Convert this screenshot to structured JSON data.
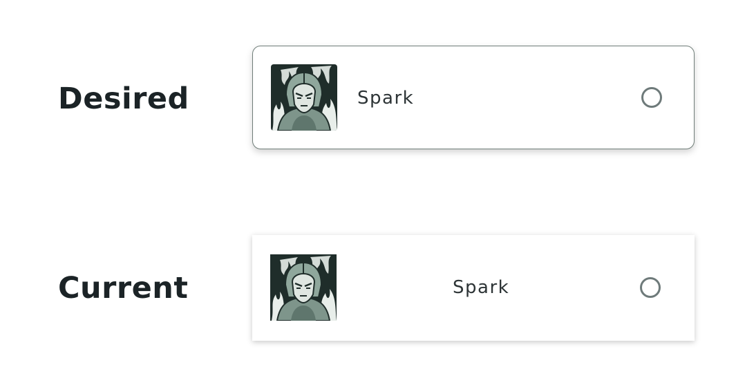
{
  "rows": {
    "desired": {
      "label": "Desired",
      "item": {
        "name": "Spark",
        "thumbnail_icon": "hero-portrait-icon",
        "selected": false
      }
    },
    "current": {
      "label": "Current",
      "item": {
        "name": "Spark",
        "thumbnail_icon": "hero-portrait-icon",
        "selected": false
      }
    }
  },
  "colors": {
    "text": "#1b2326",
    "card_border": "#6f7d78",
    "radio_ring": "#6e7a7a",
    "thumb_bg": "#1f2d2a",
    "thumb_figure": "#8fa79c"
  }
}
